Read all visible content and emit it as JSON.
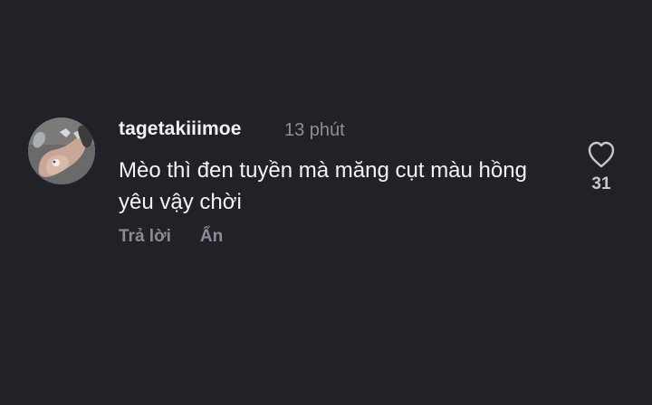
{
  "comment": {
    "username": "tagetakiiimoe",
    "timestamp": "13 phút",
    "text": "Mèo thì đen tuyền mà măng cụt màu hồng yêu vậy chời",
    "like_count": "31",
    "actions": {
      "reply_label": "Trả lời",
      "hide_label": "Ẩn"
    },
    "icons": {
      "like": "heart-outline-icon",
      "avatar": "profile-photo"
    },
    "colors": {
      "background": "#202228",
      "username": "#f2f2f4",
      "muted_text": "#8e8f96",
      "body_text": "#f3f3f5"
    }
  }
}
